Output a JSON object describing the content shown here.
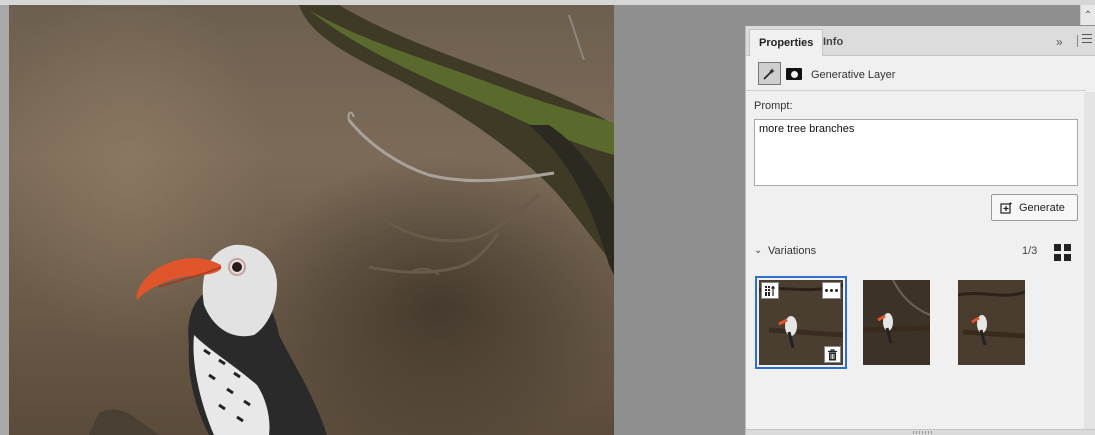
{
  "panel": {
    "tabs": [
      {
        "label": "Properties",
        "active": true
      },
      {
        "label": "Info",
        "active": false
      }
    ],
    "layer": {
      "type_icon": "generative-layer-icon",
      "mask_icon": "layer-mask-icon",
      "name": "Generative Layer"
    },
    "prompt": {
      "label": "Prompt:",
      "value": "more tree branches"
    },
    "generate_button": {
      "label": "Generate",
      "icon": "generate-icon"
    },
    "variations": {
      "label": "Variations",
      "count": "1/3",
      "expanded": true,
      "items": [
        {
          "selected": true
        },
        {
          "selected": false
        },
        {
          "selected": false
        }
      ]
    }
  },
  "colors": {
    "selection": "#2d6fd0",
    "panel_bg": "#f0f0f0",
    "canvas_bg": "#8f8f8f"
  }
}
